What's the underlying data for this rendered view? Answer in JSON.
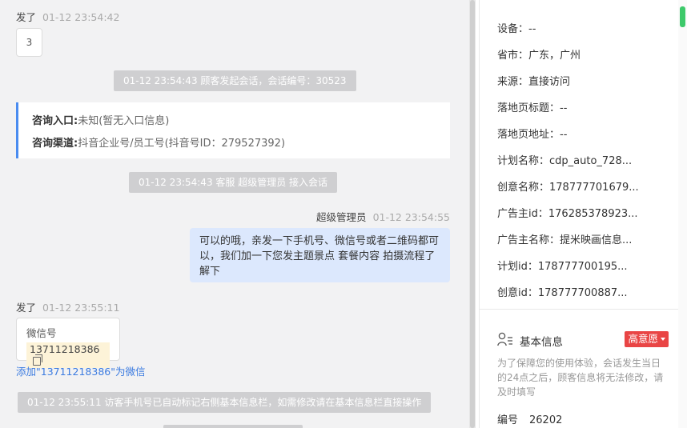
{
  "chat": {
    "msg1": {
      "sender": "发了",
      "time": "01-12 23:54:42",
      "text": "3"
    },
    "sys1": "01-12 23:54:43 顾客发起会话，会话编号：30523",
    "entry": {
      "label1": "咨询入口:",
      "value1": "未知(暂无入口信息)",
      "label2": "咨询渠道:",
      "value2": "抖音企业号/员工号(抖音号ID：279527392)"
    },
    "sys2": "01-12 23:54:43 客服 超级管理员 接入会话",
    "agent": {
      "name": "超级管理员",
      "time": "01-12 23:54:55",
      "text": "可以的哦，亲发一下手机号、微信号或者二维码都可以，我们加一下您发主题景点 套餐内容 拍摄流程了解下"
    },
    "msg2": {
      "sender": "发了",
      "time": "01-12 23:55:11",
      "card_title": "微信号",
      "wechat": "13711218386",
      "add_link": "添加\"13711218386\"为微信"
    },
    "sys3": "01-12 23:55:11 访客手机号已自动标记右侧基本信息栏，如需修改请在基本信息栏直接操作"
  },
  "panel": {
    "fields": [
      {
        "label": "设备：",
        "value": "--"
      },
      {
        "label": "省市：",
        "value": "广东，广州"
      },
      {
        "label": "来源：",
        "value": "直接访问"
      },
      {
        "label": "落地页标题：",
        "value": "--"
      },
      {
        "label": "落地页地址：",
        "value": "--"
      },
      {
        "label": "计划名称：",
        "value": "cdp_auto_728..."
      },
      {
        "label": "创意名称：",
        "value": "178777701679..."
      },
      {
        "label": "广告主id：",
        "value": "176285378923..."
      },
      {
        "label": "广告主名称：",
        "value": "提米映画信息..."
      },
      {
        "label": "计划id：",
        "value": "178777700195..."
      },
      {
        "label": "创意id：",
        "value": "178777700887..."
      }
    ],
    "basic_info": {
      "title": "基本信息",
      "badge": "高意愿",
      "notice": "为了保障您的使用体验，会话发生当日的24点之后，顾客信息将无法修改，请及时填写",
      "id_label": "编号",
      "id_value": "26202"
    }
  },
  "colors": {
    "accent": "#4a8cf0",
    "badge": "#e94545",
    "agent_bubble": "#dce8fd",
    "scroll_green": "#3dc96a"
  }
}
